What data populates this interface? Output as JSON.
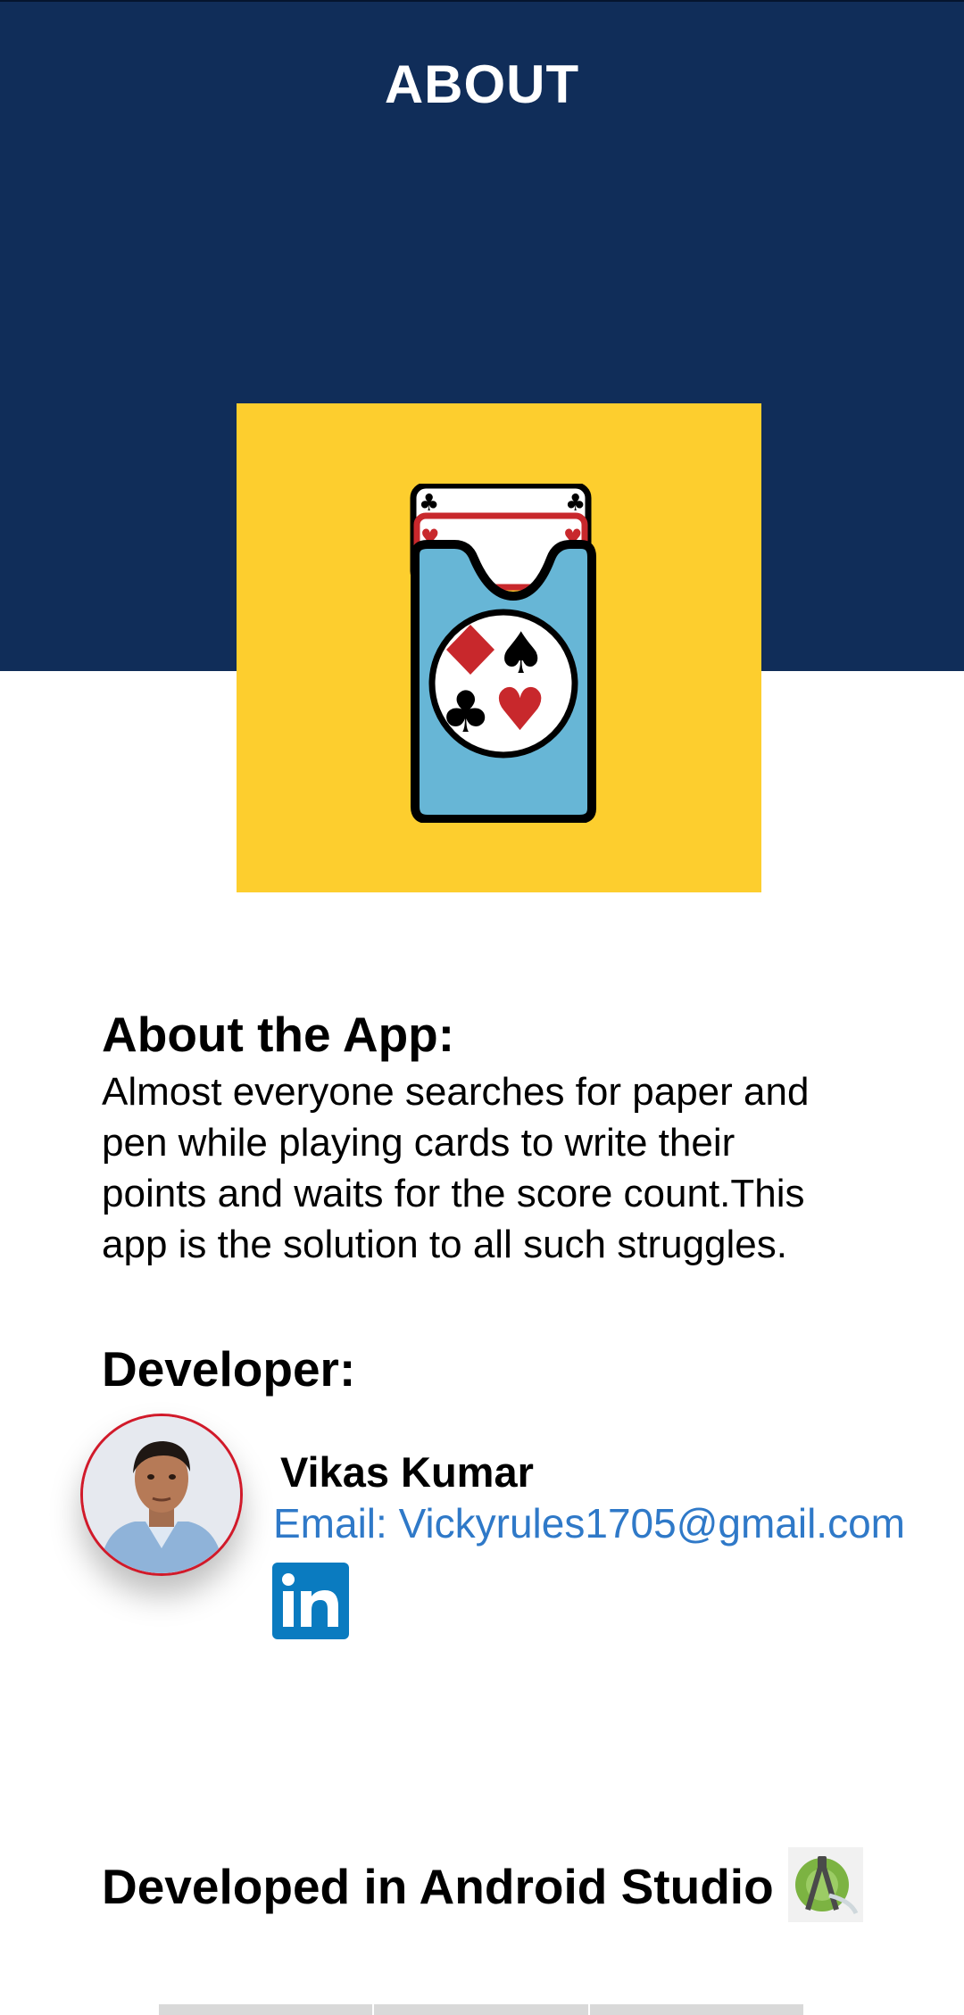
{
  "header": {
    "title": "ABOUT"
  },
  "about": {
    "heading": "About the App:",
    "text": "Almost everyone searches for paper and pen while playing cards to write their points and waits for the score count.This app is the solution to all such struggles."
  },
  "developer": {
    "heading": "Developer:",
    "name": "Vikas Kumar",
    "email": "Email: Vickyrules1705@gmail.com",
    "linkedin_icon": "linkedin-icon"
  },
  "footer": {
    "text": "Developed in Android Studio",
    "icon": "android-studio-icon"
  },
  "colors": {
    "header_bg": "#102d59",
    "logo_bg": "#fdce2e",
    "email_link": "#2f79c8",
    "linkedin": "#0a7bc0"
  }
}
